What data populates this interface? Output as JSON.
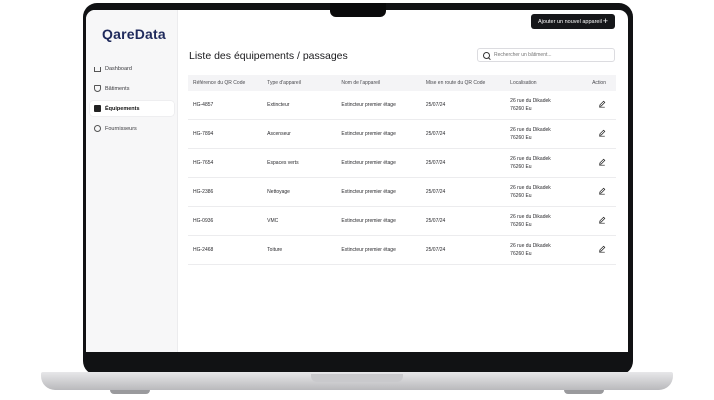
{
  "app": {
    "logo": "QareData"
  },
  "header": {
    "add_button_label": "Ajouter un nouvel appareil",
    "add_button_icon": "plus-icon"
  },
  "sidebar": {
    "items": [
      {
        "label": "Dashboard",
        "icon": "home-icon",
        "active": false
      },
      {
        "label": "Bâtiments",
        "icon": "shield-icon",
        "active": false
      },
      {
        "label": "Équipements",
        "icon": "box-icon",
        "active": true
      },
      {
        "label": "Fournisseurs",
        "icon": "user-icon",
        "active": false
      }
    ]
  },
  "main": {
    "title": "Liste des équipements / passages",
    "search": {
      "placeholder": "Rechercher un bâtiment...",
      "value": ""
    },
    "table": {
      "columns": [
        "Référence du QR Code",
        "Type d'appareil",
        "Nom de l'appareil",
        "Mise en route du QR Code",
        "Localisation",
        "Action"
      ],
      "rows": [
        {
          "ref": "HG-4857",
          "type": "Extincteur",
          "name": "Extincteur premier étage",
          "date": "25/07/24",
          "loc1": "26 rue du Dikadek",
          "loc2": "76260 Eu"
        },
        {
          "ref": "HG-7894",
          "type": "Ascenseur",
          "name": "Extincteur premier étage",
          "date": "25/07/24",
          "loc1": "26 rue du Dikadek",
          "loc2": "76260 Eu"
        },
        {
          "ref": "HG-7654",
          "type": "Espaces verts",
          "name": "Extincteur premier étage",
          "date": "25/07/24",
          "loc1": "26 rue du Dikadek",
          "loc2": "76260 Eu"
        },
        {
          "ref": "HG-2386",
          "type": "Nettoyage",
          "name": "Extincteur premier étage",
          "date": "25/07/24",
          "loc1": "26 rue du Dikadek",
          "loc2": "76260 Eu"
        },
        {
          "ref": "HG-0936",
          "type": "VMC",
          "name": "Extincteur premier étage",
          "date": "25/07/24",
          "loc1": "26 rue du Dikadek",
          "loc2": "76260 Eu"
        },
        {
          "ref": "HG-2468",
          "type": "Toiture",
          "name": "Extincteur premier étage",
          "date": "25/07/24",
          "loc1": "26 rue du Dikadek",
          "loc2": "76260 Eu"
        }
      ]
    }
  },
  "colors": {
    "brand": "#1f2a5c",
    "button": "#16171a",
    "header_row": "#f4f4f6"
  }
}
